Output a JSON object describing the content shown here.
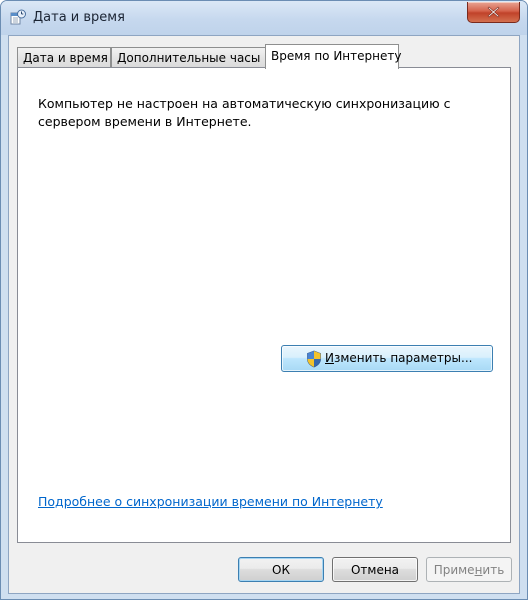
{
  "window": {
    "title": "Дата и время",
    "icon": "date-time-icon",
    "close_icon": "close-icon"
  },
  "tabs": [
    {
      "label": "Дата и время",
      "active": false
    },
    {
      "label": "Дополнительные часы",
      "active": false
    },
    {
      "label": "Время по Интернету",
      "active": true
    }
  ],
  "panel": {
    "message_line1": "Компьютер не настроен на автоматическую синхронизацию с",
    "message_line2": "сервером времени в Интернете.",
    "change_button": {
      "icon": "uac-shield-icon",
      "mnemonic": "И",
      "label_rest": "зменить параметры..."
    },
    "help_link": "Подробнее о синхронизации времени по Интернету"
  },
  "buttons": {
    "ok": "ОК",
    "cancel": "Отмена",
    "apply_pre": "Приме",
    "apply_mnemonic": "н",
    "apply_post": "ить",
    "apply_enabled": false
  },
  "colors": {
    "link": "#0066cc",
    "frame": "#cfdff0",
    "close": "#c0422a"
  }
}
